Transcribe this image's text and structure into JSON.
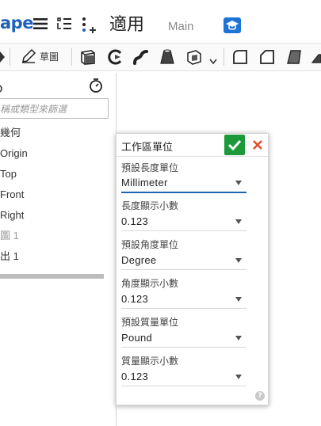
{
  "topbar": {
    "brand": "ape",
    "title": "適用",
    "tab": "Main"
  },
  "toolbar": {
    "sketch_label": "草圖"
  },
  "feature_tree": {
    "filter_placeholder": "稱或類型來篩選",
    "items": [
      {
        "label": "幾何",
        "muted": false
      },
      {
        "label": "Origin",
        "muted": false
      },
      {
        "label": "Top",
        "muted": false
      },
      {
        "label": "Front",
        "muted": false
      },
      {
        "label": "Right",
        "muted": false
      },
      {
        "label": "圖 1",
        "muted": true
      },
      {
        "label": "出 1",
        "muted": false
      }
    ]
  },
  "dialog": {
    "title": "工作區單位",
    "help": "?",
    "fields": [
      {
        "label": "預設長度單位",
        "value": "Millimeter"
      },
      {
        "label": "長度顯示小數",
        "value": "0.123"
      },
      {
        "label": "預設角度單位",
        "value": "Degree"
      },
      {
        "label": "角度顯示小數",
        "value": "0.123"
      },
      {
        "label": "預設質量單位",
        "value": "Pound"
      },
      {
        "label": "質量顯示小數",
        "value": "0.123"
      }
    ]
  },
  "colors": {
    "brand": "#1e62b8",
    "confirm": "#1c9a3a",
    "cancel": "#e0502a"
  }
}
